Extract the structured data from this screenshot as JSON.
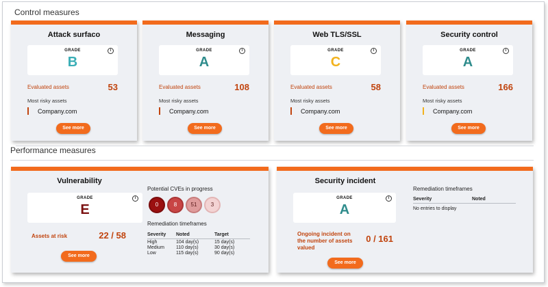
{
  "control_section_title": "Control measures",
  "performance_section_title": "Performance measures",
  "grade_label": "GRADE",
  "info_glyph": "i",
  "see_more_label": "See more",
  "control_cards": [
    {
      "title": "Attack surfaco",
      "grade": "B",
      "grade_color": "#3aaeb6",
      "evaluated_label": "Evaluated assets",
      "evaluated_value": "53",
      "risky_label": "Most risky assets",
      "risky_asset": "Company.com",
      "risky_bar_color": "#c1440e"
    },
    {
      "title": "Messaging",
      "grade": "A",
      "grade_color": "#2f8c8c",
      "evaluated_label": "Evaluated assets",
      "evaluated_value": "108",
      "risky_label": "Most risky assets",
      "risky_asset": "Company.com",
      "risky_bar_color": "#c1440e"
    },
    {
      "title": "Web TLS/SSL",
      "grade": "C",
      "grade_color": "#f2b21d",
      "evaluated_label": "Evaluated assets",
      "evaluated_value": "58",
      "risky_label": "Most risky assets",
      "risky_asset": "Company.com",
      "risky_bar_color": "#c1440e"
    },
    {
      "title": "Security control",
      "grade": "A",
      "grade_color": "#2f8c8c",
      "evaluated_label": "Evaluated assets",
      "evaluated_value": "166",
      "risky_label": "Most risky assets",
      "risky_asset": "Company.com",
      "risky_bar_color": "#f2b21d"
    }
  ],
  "vulnerability": {
    "title": "Vulnerability",
    "grade": "E",
    "grade_color": "#7a1010",
    "assets_label": "Assets at risk",
    "assets_value": "22 / 58",
    "cves_title": "Potential CVEs in progress",
    "cves": [
      {
        "value": "0",
        "fill": "#9b1010",
        "border": "#7a0c0c",
        "text_color": "#ffffff"
      },
      {
        "value": "8",
        "fill": "#c84545",
        "border": "#a93535",
        "text_color": "#ffffff"
      },
      {
        "value": "51",
        "fill": "#df9b9b",
        "border": "#c77c7c",
        "text_color": "#5a1a1a"
      },
      {
        "value": "3",
        "fill": "#f3d3d3",
        "border": "#e2b4b4",
        "text_color": "#5a1a1a"
      }
    ],
    "remediation_title": "Remediation timeframes",
    "table_headers": [
      "Severity",
      "Noted",
      "Target"
    ],
    "table_rows": [
      [
        "High",
        "104 day(s)",
        "15 day(s)"
      ],
      [
        "Medium",
        "110 day(s)",
        "30 day(s)"
      ],
      [
        "Low",
        "115 day(s)",
        "90 day(s)"
      ]
    ]
  },
  "incident": {
    "title": "Security incident",
    "grade": "A",
    "grade_color": "#2f8c8c",
    "ongoing_label": "Ongoing incident on the number of assets valued",
    "ongoing_value": "0 / 161",
    "remediation_title": "Remediation timeframes",
    "table_headers": [
      "Severity",
      "Noted"
    ],
    "empty_text": "No entries to display"
  }
}
